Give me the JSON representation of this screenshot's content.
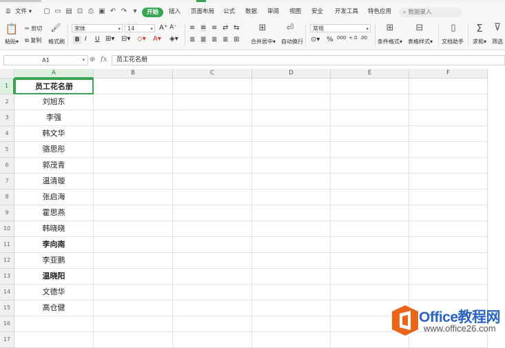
{
  "colors": {
    "accent": "#39a554",
    "watermark_orange": "#e8651a",
    "watermark_blue": "#2a64c0"
  },
  "menubar": {
    "file_label": "文件",
    "tabs": [
      "开始",
      "插入",
      "页面布局",
      "公式",
      "数据",
      "审阅",
      "视图",
      "安全",
      "开发工具",
      "特色应用"
    ],
    "active_tab": "开始",
    "search_placeholder": "数据录入",
    "quick_access_icons": [
      "new-icon",
      "open-icon",
      "save-icon",
      "export-icon",
      "print-icon",
      "preview-icon",
      "undo-icon",
      "redo-icon",
      "more-icon"
    ]
  },
  "ribbon": {
    "paste": "粘贴",
    "cut": "剪切",
    "copy": "复制",
    "format_painter": "格式刷",
    "font_name": "宋体",
    "font_size": "14",
    "merge_center": "合并居中",
    "wrap_text": "自动换行",
    "number_format": "常规",
    "conditional_format": "条件格式",
    "table_style": "表格样式",
    "doc_helper": "文档助手",
    "sum": "求和",
    "filter": "筛选"
  },
  "formula_bar": {
    "cell_ref": "A1",
    "fx_label": "fx",
    "content": "员工花名册"
  },
  "sheet": {
    "columns": [
      "A",
      "B",
      "C",
      "D",
      "E",
      "F"
    ],
    "active_column": "A",
    "active_row": "1",
    "rows": [
      {
        "num": "1",
        "a": "员工花名册"
      },
      {
        "num": "2",
        "a": "刘旭东"
      },
      {
        "num": "3",
        "a": "李强"
      },
      {
        "num": "4",
        "a": "韩文华"
      },
      {
        "num": "5",
        "a": "骆思彤"
      },
      {
        "num": "6",
        "a": "郭茂青"
      },
      {
        "num": "7",
        "a": "温清璇"
      },
      {
        "num": "8",
        "a": "张启海"
      },
      {
        "num": "9",
        "a": "霍思燕"
      },
      {
        "num": "10",
        "a": "韩晓晓"
      },
      {
        "num": "11",
        "a": "李向南"
      },
      {
        "num": "12",
        "a": "李亚鹏"
      },
      {
        "num": "13",
        "a": "温晓阳"
      },
      {
        "num": "14",
        "a": "文德华"
      },
      {
        "num": "15",
        "a": "高仓健"
      },
      {
        "num": "16",
        "a": ""
      },
      {
        "num": "17",
        "a": ""
      }
    ],
    "bold_rows": [
      "1",
      "11",
      "13"
    ]
  },
  "watermark": {
    "brand": "Office教程网",
    "url": "www.office26.com"
  }
}
